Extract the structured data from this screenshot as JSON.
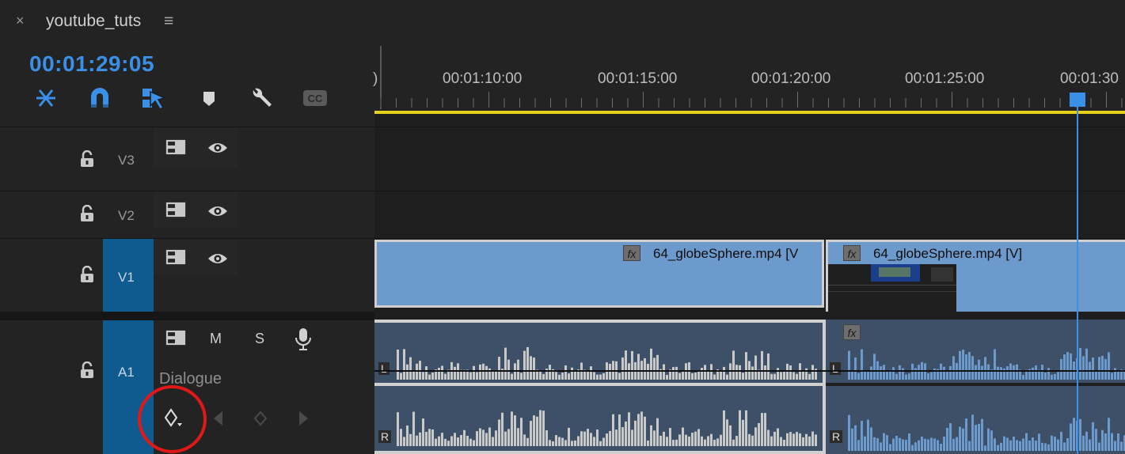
{
  "sequence": {
    "tab_close": "×",
    "name": "youtube_tuts",
    "menu": "≡",
    "timecode": "00:01:29:05"
  },
  "toolbar": [
    {
      "name": "snap-in-sequence-icon"
    },
    {
      "name": "magnet-icon"
    },
    {
      "name": "linked-selection-icon"
    },
    {
      "name": "marker-icon"
    },
    {
      "name": "wrench-icon"
    },
    {
      "name": "cc-icon",
      "label": "CC"
    }
  ],
  "ruler": {
    "labels": [
      "00:01:10:00",
      "00:01:15:00",
      "00:01:20:00",
      "00:01:25:00",
      "00:01:30"
    ],
    "edge": ")"
  },
  "tracks": {
    "v3": {
      "label": "V3"
    },
    "v2": {
      "label": "V2"
    },
    "v1": {
      "label": "V1"
    },
    "a1": {
      "label": "A1",
      "mute": "M",
      "solo": "S",
      "name": "Dialogue"
    }
  },
  "clips": {
    "video": [
      {
        "label": "64_globeSphere.mp4 [V"
      },
      {
        "label": "64_globeSphere.mp4 [V]"
      }
    ],
    "fx": "fx",
    "audio_channels": [
      "L",
      "R"
    ]
  },
  "colors": {
    "accent": "#3a8fe6",
    "work_area": "#e6d21a",
    "clip_video": "#6d9acd",
    "track_select": "#0f5a8f",
    "highlight_circle": "#e01818"
  }
}
